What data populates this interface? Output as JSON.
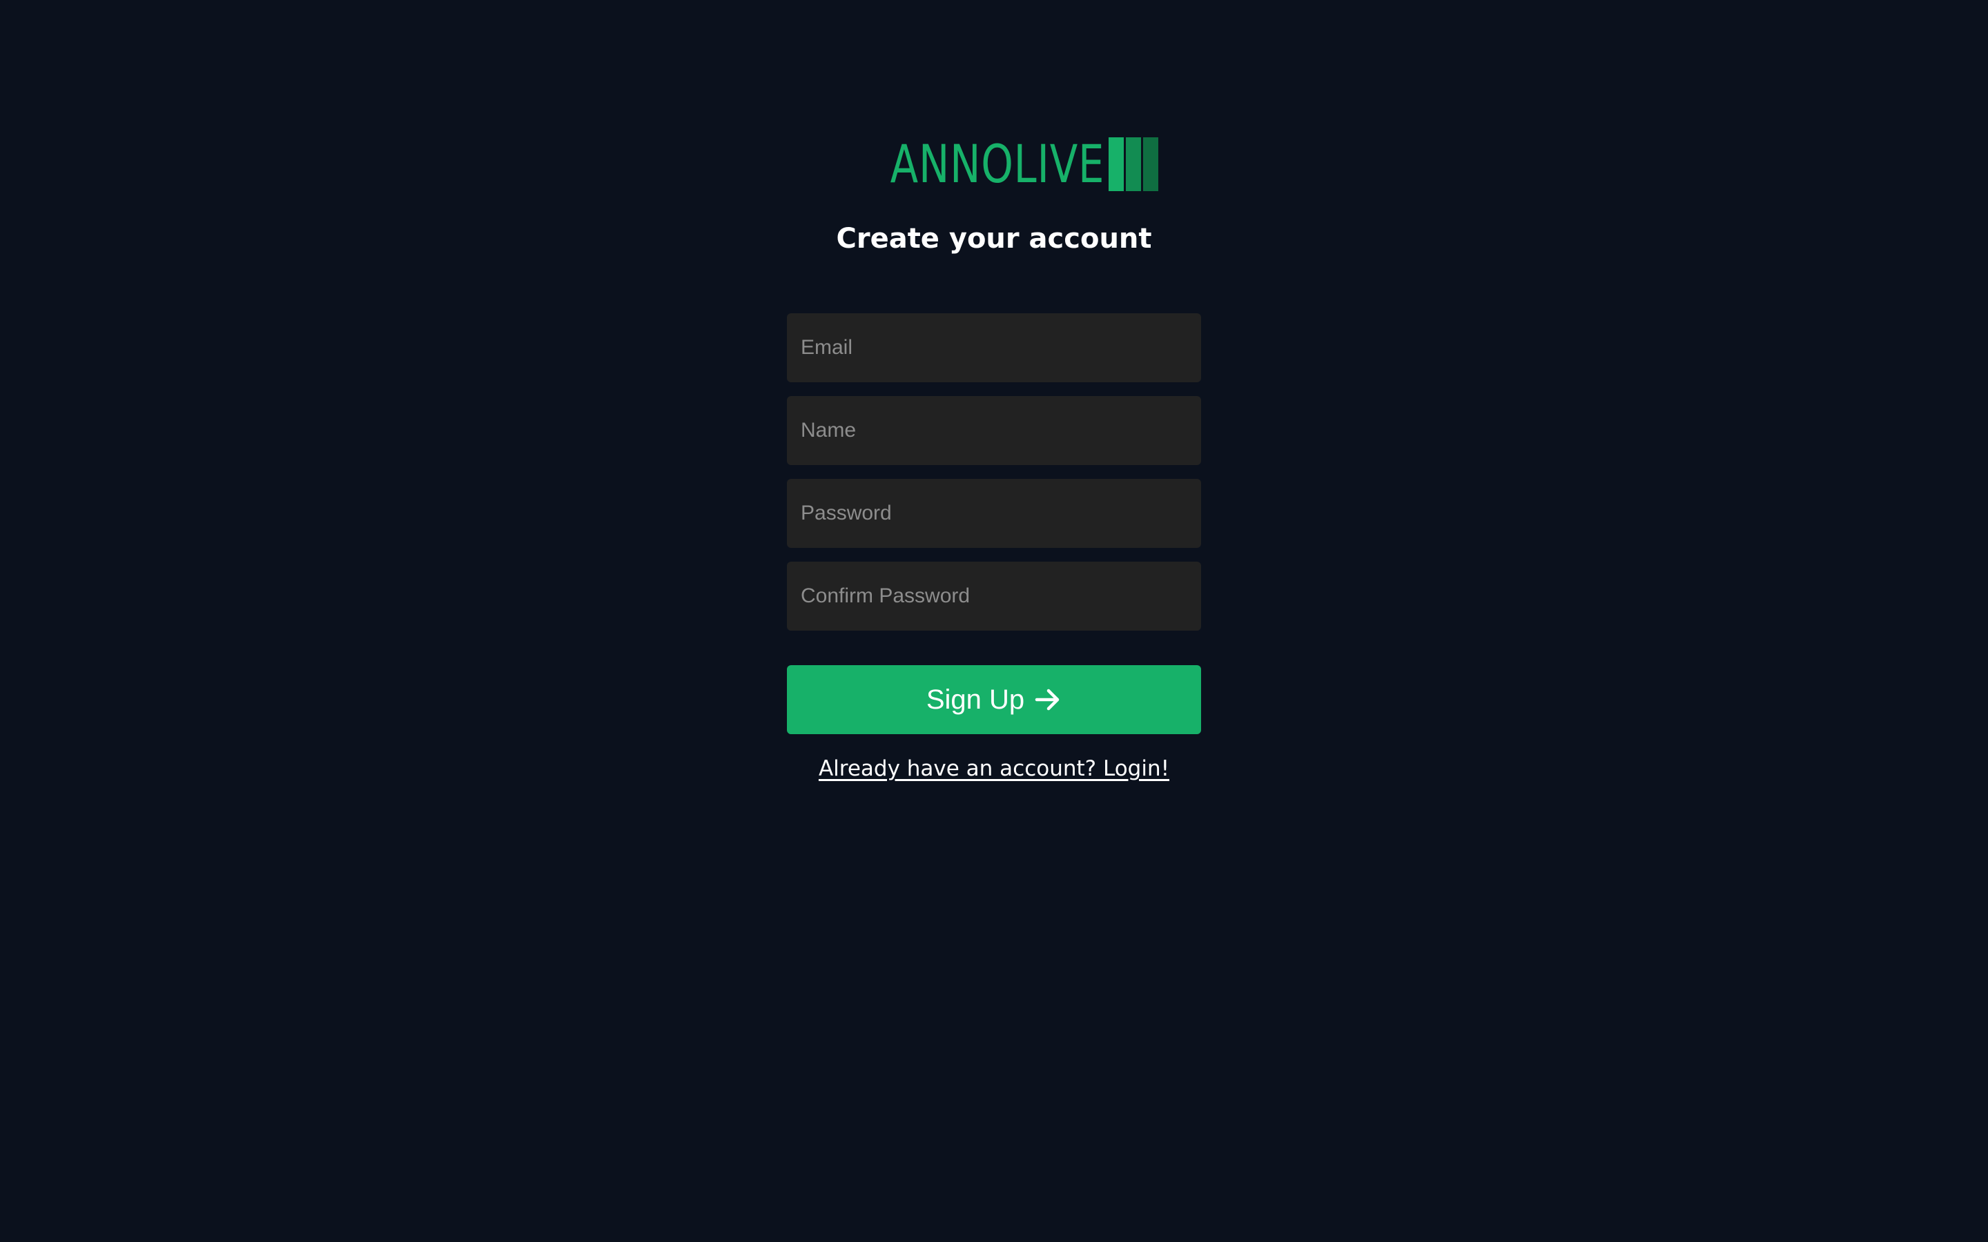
{
  "brand": {
    "name": "ANNOLIVE",
    "color": "#17b169",
    "logo_icon": "three-bars-icon"
  },
  "page": {
    "title": "Create your account",
    "background": "#0b111d"
  },
  "form": {
    "email": {
      "placeholder": "Email",
      "value": ""
    },
    "name": {
      "placeholder": "Name",
      "value": ""
    },
    "password": {
      "placeholder": "Password",
      "value": ""
    },
    "confirm_password": {
      "placeholder": "Confirm Password",
      "value": ""
    },
    "field_background": "#222222"
  },
  "signup_button": {
    "label": "Sign Up",
    "icon": "arrow-right-icon",
    "color": "#17b169"
  },
  "login_link": {
    "text": "Already have an account? Login!"
  }
}
